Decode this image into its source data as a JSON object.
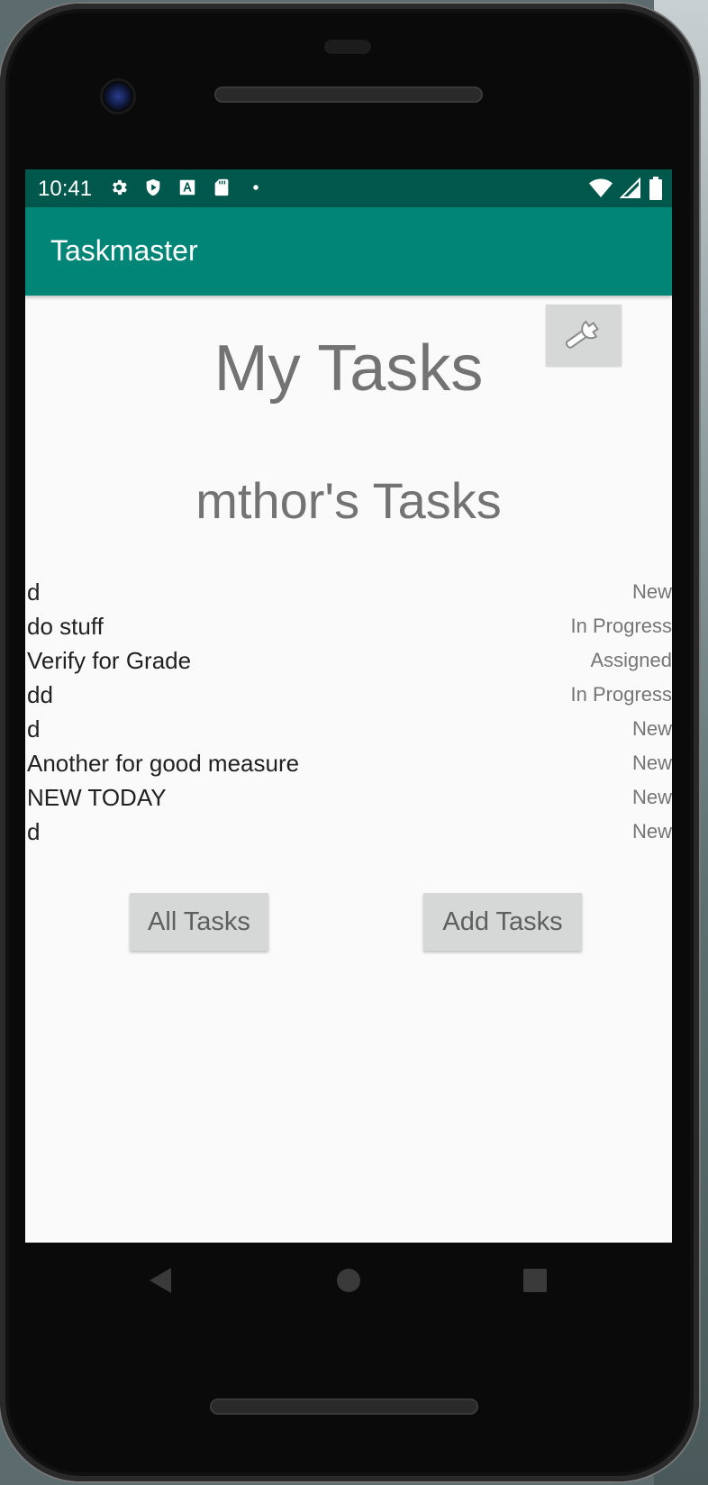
{
  "status_bar": {
    "time": "10:41",
    "left_icons": [
      "gear-icon",
      "shield-icon",
      "font-icon",
      "sd-card-icon",
      "dot-icon"
    ],
    "right_icons": [
      "wifi-icon",
      "signal-icon",
      "battery-icon"
    ]
  },
  "app_bar": {
    "title": "Taskmaster",
    "color": "#008577",
    "status_color": "#00574b"
  },
  "settings_button": {
    "icon": "wrench-icon"
  },
  "main": {
    "page_title": "My Tasks",
    "user_title": "mthor's Tasks"
  },
  "tasks": [
    {
      "name": "d",
      "status": "New"
    },
    {
      "name": "do stuff",
      "status": "In Progress"
    },
    {
      "name": "Verify for Grade",
      "status": "Assigned"
    },
    {
      "name": "dd",
      "status": "In Progress"
    },
    {
      "name": "d",
      "status": "New"
    },
    {
      "name": "Another for good measure",
      "status": "New"
    },
    {
      "name": "NEW TODAY",
      "status": "New"
    },
    {
      "name": "d",
      "status": "New"
    }
  ],
  "buttons": {
    "all_tasks": "All Tasks",
    "add_tasks": "Add Tasks"
  },
  "nav_bar": {
    "icons": [
      "back-icon",
      "home-icon",
      "recents-icon"
    ]
  }
}
